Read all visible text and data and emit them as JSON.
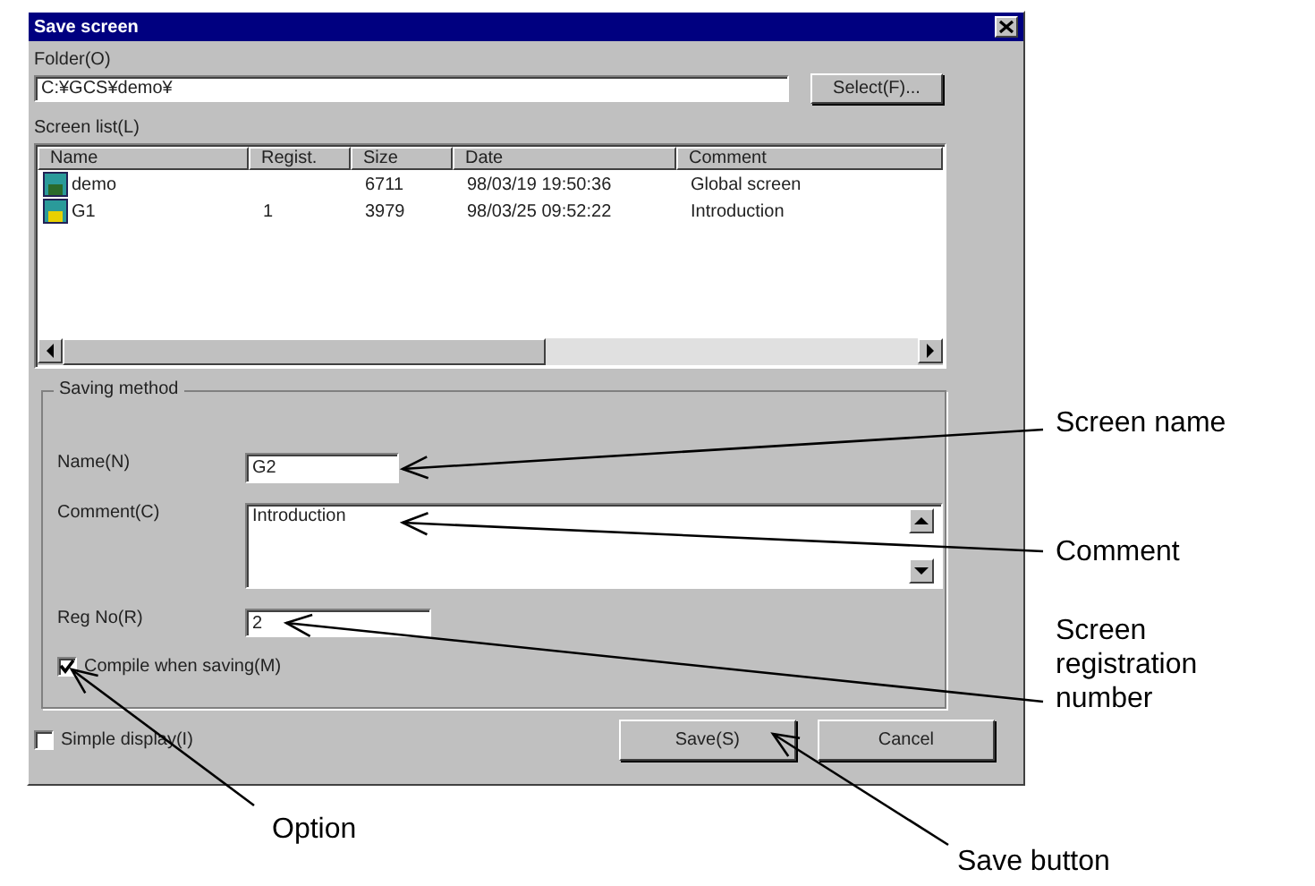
{
  "window": {
    "title": "Save screen"
  },
  "folder": {
    "label": "Folder(O)",
    "value": "C:¥GCS¥demo¥",
    "button": "Select(F)..."
  },
  "screen_list": {
    "label": "Screen list(L)",
    "columns": [
      "Name",
      "Regist.",
      "Size",
      "Date",
      "Comment"
    ],
    "rows": [
      {
        "name": "demo",
        "regist": "",
        "size": "6711",
        "date": "98/03/19 19:50:36",
        "comment": "Global screen",
        "selected": false
      },
      {
        "name": "G1",
        "regist": "1",
        "size": "3979",
        "date": "98/03/25 09:52:22",
        "comment": "Introduction",
        "selected": false
      }
    ]
  },
  "saving_method": {
    "title": "Saving method",
    "name_label": "Name(N)",
    "name_value": "G2",
    "comment_label": "Comment(C)",
    "comment_value": "Introduction",
    "reg_label": "Reg No(R)",
    "reg_value": "2",
    "compile": {
      "label": "Compile when saving(M)",
      "checked": true
    }
  },
  "simple_display": {
    "label": "Simple display(I)",
    "checked": false
  },
  "buttons": [
    "Save(S)",
    "Cancel"
  ],
  "annotations": [
    "Screen name",
    "Comment",
    "Screen registration number",
    "Option",
    "Save button"
  ]
}
